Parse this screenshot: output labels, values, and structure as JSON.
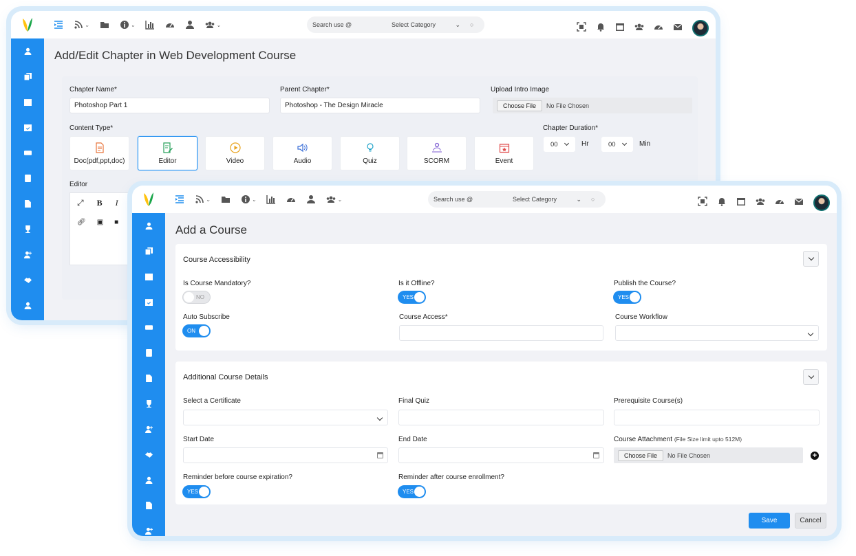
{
  "colors": {
    "accent": "#1f8def",
    "sidebar": "#1f8def",
    "save": "#1f8def"
  },
  "common": {
    "search_placeholder": "Search use @",
    "category_placeholder": "Select Category",
    "no_file": "No File Chosen",
    "choose_file": "Choose File"
  },
  "topbar_icons": [
    "menu-collapse-icon",
    "rss-icon",
    "folder-icon",
    "info-icon",
    "bar-chart-icon",
    "dashboard-gauge-icon",
    "user-icon",
    "users-group-icon"
  ],
  "topbar_right_icons": [
    "scan-icon",
    "bell-icon",
    "calendar-icon",
    "users-group-icon",
    "dashboard-gauge-icon",
    "mail-icon"
  ],
  "sidebar_icons_w1": [
    "user-icon",
    "copy-icon",
    "calendar-icon",
    "calendar-check-icon",
    "ticket-icon",
    "contact-card-icon",
    "document-icon",
    "trophy-icon",
    "user-plus-icon",
    "handshake-icon",
    "user-tie-icon"
  ],
  "sidebar_icons_w2": [
    "user-icon",
    "copy-icon",
    "calendar-icon",
    "calendar-check-icon",
    "ticket-icon",
    "contact-card-icon",
    "document-icon",
    "trophy-icon",
    "user-plus-icon",
    "handshake-icon",
    "user-tie-icon",
    "document-icon",
    "user-plus-icon"
  ],
  "chapter": {
    "page_title": "Add/Edit Chapter in Web Development Course",
    "chapter_name_label": "Chapter Name*",
    "chapter_name_value": "Photoshop  Part 1",
    "parent_chapter_label": "Parent Chapter*",
    "parent_chapter_value": "Photoshop - The Design Miracle",
    "upload_label": "Upload Intro Image",
    "content_type_label": "Content Type*",
    "content_types": [
      "Doc(pdf,ppt,doc)",
      "Editor",
      "Video",
      "Audio",
      "Quiz",
      "SCORM",
      "Event"
    ],
    "selected_content_type": "Editor",
    "duration_label": "Chapter Duration*",
    "hours_value": "00",
    "hours_unit": "Hr",
    "minutes_value": "00",
    "minutes_unit": "Min",
    "editor_label": "Editor",
    "editor_tools_row1": [
      "B",
      "I"
    ]
  },
  "course": {
    "page_title": "Add a Course",
    "accessibility_title": "Course Accessibility",
    "mandatory_label": "Is Course Mandatory?",
    "mandatory_toggle": "NO",
    "offline_label": "Is it Offline?",
    "offline_toggle": "YES",
    "publish_label": "Publish the Course?",
    "publish_toggle": "YES",
    "auto_subscribe_label": "Auto Subscribe",
    "auto_subscribe_toggle": "ON",
    "access_label": "Course Access*",
    "workflow_label": "Course Workflow",
    "details_title": "Additional Course Details",
    "certificate_label": "Select a Certificate",
    "final_quiz_label": "Final Quiz",
    "prereq_label": "Prerequisite Course(s)",
    "start_date_label": "Start Date",
    "end_date_label": "End Date",
    "attachment_label": "Course Attachment",
    "attachment_note": "(File Size limit upto 512M)",
    "reminder_expiry_label": "Reminder before course expiration?",
    "reminder_expiry_toggle": "YES",
    "reminder_enroll_label": "Reminder after course enrollment?",
    "reminder_enroll_toggle": "YES",
    "save_label": "Save",
    "cancel_label": "Cancel"
  }
}
